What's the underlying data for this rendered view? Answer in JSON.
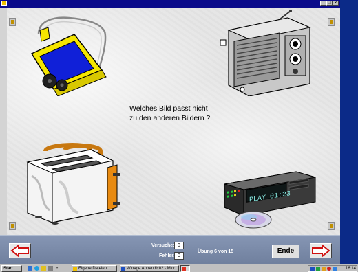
{
  "window": {
    "title_controls": [
      "_",
      "□",
      "×"
    ]
  },
  "question": {
    "line1": "Welches Bild passt nicht",
    "line2": "zu den anderen Bildern ?"
  },
  "pictures": [
    {
      "name": "wheelbarrow"
    },
    {
      "name": "radio"
    },
    {
      "name": "toaster"
    },
    {
      "name": "cd-player"
    }
  ],
  "cd_display": "PLAY 01:23",
  "bottom": {
    "versuche_label": "Versuche:",
    "versuche_value": "0",
    "fehler_label": "Fehler:",
    "fehler_value": "0",
    "progress": "Übung 6 von 15",
    "ende_label": "Ende",
    "prev_icon": "arrow-left-icon",
    "next_icon": "arrow-right-icon"
  },
  "taskbar": {
    "start_label": "Start",
    "chevron": "»",
    "tasks": [
      {
        "label": "Eigene Dateien"
      },
      {
        "label": "Winage Appendix02 - Micr..."
      }
    ],
    "clock": "16:14"
  },
  "colors": {
    "bottombar": "#7a8aa8",
    "arrow_red": "#d01010",
    "desktop_blue": "#0b2a88"
  }
}
